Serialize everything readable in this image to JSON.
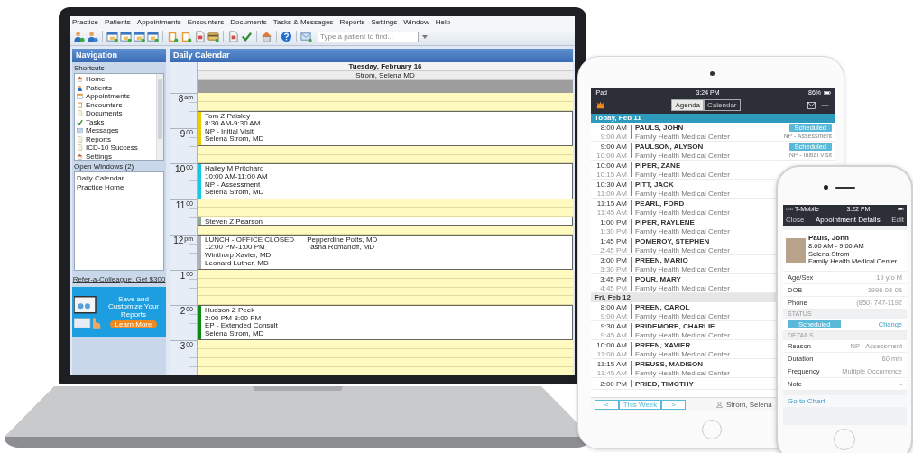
{
  "laptop": {
    "menu": [
      "Practice",
      "Patients",
      "Appointments",
      "Encounters",
      "Documents",
      "Tasks & Messages",
      "Reports",
      "Settings",
      "Window",
      "Help"
    ],
    "search": {
      "placeholder": "Type a patient to find..."
    },
    "navigation": {
      "title": "Navigation",
      "shortcuts_label": "Shortcuts",
      "shortcuts": [
        "Home",
        "Patients",
        "Appointments",
        "Encounters",
        "Documents",
        "Tasks",
        "Messages",
        "Reports",
        "ICD-10 Success",
        "Settings"
      ],
      "open_windows_label": "Open Windows (2)",
      "open_windows": [
        "Daily Calendar",
        "Practice Home"
      ],
      "referral_link": "Refer-a-Colleague, Get $300",
      "ad": {
        "text": "Save and Customize Your Reports",
        "button": "Learn More"
      }
    },
    "calendar": {
      "title": "Daily Calendar",
      "date": "Tuesday, February 16",
      "provider": "Strom, Selena MD",
      "hours": [
        {
          "hour": "8",
          "suffix": "am"
        },
        {
          "hour": "9",
          "suffix": "00"
        },
        {
          "hour": "10",
          "suffix": "00"
        },
        {
          "hour": "11",
          "suffix": "00"
        },
        {
          "hour": "12",
          "suffix": "pm"
        },
        {
          "hour": "1",
          "suffix": "00"
        },
        {
          "hour": "2",
          "suffix": "00"
        },
        {
          "hour": "3",
          "suffix": "00"
        }
      ],
      "slots": [
        {
          "kind": "free"
        },
        {
          "kind": "free"
        },
        {
          "kind": "appointment",
          "short": false,
          "color": "#e8d000",
          "lines": [
            "Tom Z Paisley",
            "8:30 AM-9:30 AM",
            "NP - Initial Visit",
            "Selena Strom, MD"
          ]
        },
        {
          "kind": "free"
        },
        {
          "kind": "free"
        },
        {
          "kind": "appointment",
          "short": false,
          "color": "#18c8e0",
          "lines": [
            "Hailey M Pritchard",
            "10:00 AM-11:00 AM",
            "NP - Assessment",
            "Selena Strom, MD"
          ]
        },
        {
          "kind": "free"
        },
        {
          "kind": "free"
        },
        {
          "kind": "appointment",
          "short": true,
          "color": "#8fa88f",
          "lines": [
            "Steven Z Pearson"
          ]
        },
        {
          "kind": "free"
        },
        {
          "kind": "appointment",
          "short": false,
          "color": "#b0b0b0",
          "lines": [
            "LUNCH - OFFICE CLOSED",
            "12:00 PM-1:00 PM",
            "Winthorp Xavier, MD",
            "Leonard Luther, MD",
            "Pepperdine Potts, MD",
            "Tasha Romanoff, MD"
          ]
        },
        {
          "kind": "free"
        },
        {
          "kind": "free"
        },
        {
          "kind": "free"
        },
        {
          "kind": "free"
        },
        {
          "kind": "appointment",
          "short": false,
          "color": "#108a10",
          "lines": [
            "Hudson Z Peek",
            "2:00 PM-3:00 PM",
            "EP - Extended Consult",
            "Selena Strom, MD"
          ]
        },
        {
          "kind": "free"
        },
        {
          "kind": "free"
        },
        {
          "kind": "free"
        },
        {
          "kind": "free"
        }
      ]
    }
  },
  "tablet": {
    "status_bar": {
      "device": "iPad",
      "time": "3:24 PM",
      "battery": "86%"
    },
    "segments": [
      {
        "label": "Agenda",
        "selected": true
      },
      {
        "label": "Calendar",
        "selected": false
      }
    ],
    "sections": [
      {
        "title": "Today, Feb 11",
        "kind": "today",
        "rows": [
          {
            "start": "8:00 AM",
            "end": "9:00 AM",
            "name": "PAULS, JOHN",
            "location": "Family Health Medical Center",
            "status": "Scheduled",
            "reason": "NP - Assessment"
          },
          {
            "start": "9:00 AM",
            "end": "10:00 AM",
            "name": "PAULSON, ALYSON",
            "location": "Family Health Medical Center",
            "status": "Scheduled",
            "reason": "NP - Initial Visit"
          },
          {
            "start": "10:00 AM",
            "end": "10:15 AM",
            "name": "PIPER, ZANE",
            "location": "Family Health Medical Center"
          },
          {
            "start": "10:30 AM",
            "end": "11:00 AM",
            "name": "PITT, JACK",
            "location": "Family Health Medical Center"
          },
          {
            "start": "11:15 AM",
            "end": "11:45 AM",
            "name": "PEARL, FORD",
            "location": "Family Health Medical Center"
          },
          {
            "start": "1:00 PM",
            "end": "1:30 PM",
            "name": "PIPER, RAYLENE",
            "location": "Family Health Medical Center"
          },
          {
            "start": "1:45 PM",
            "end": "2:45 PM",
            "name": "POMEROY, STEPHEN",
            "location": "Family Health Medical Center"
          },
          {
            "start": "3:00 PM",
            "end": "3:30 PM",
            "name": "PREEN, MARIO",
            "location": "Family Health Medical Center"
          },
          {
            "start": "3:45 PM",
            "end": "4:45 PM",
            "name": "POUR, MARY",
            "location": "Family Health Medical Center"
          }
        ]
      },
      {
        "title": "Fri, Feb 12",
        "kind": "later",
        "rows": [
          {
            "start": "8:00 AM",
            "end": "9:00 AM",
            "name": "PREEN, CAROL",
            "location": "Family Health Medical Center"
          },
          {
            "start": "9:30 AM",
            "end": "9:45 AM",
            "name": "PRIDEMORE, CHARLIE",
            "location": "Family Health Medical Center"
          },
          {
            "start": "10:00 AM",
            "end": "11:00 AM",
            "name": "PREEN, XAVIER",
            "location": "Family Health Medical Center"
          },
          {
            "start": "11:15 AM",
            "end": "11:45 AM",
            "name": "PREUSS, MADISON",
            "location": "Family Health Medical Center"
          },
          {
            "start": "2:00 PM",
            "name": "PRIED, TIMOTHY"
          }
        ]
      }
    ],
    "bottom_bar": {
      "previous": "<",
      "range": "This Week",
      "next": ">",
      "provider": "Strom, Selena"
    }
  },
  "phone": {
    "status_bar": {
      "carrier": "T-Mobile",
      "time": "3:22 PM"
    },
    "nav": {
      "left": "Close",
      "title": "Appointment Details",
      "right": "Edit"
    },
    "patient": {
      "name": "Pauls, John",
      "time": "8:00 AM - 9:00 AM",
      "provider": "Selena Strom",
      "location": "Family Health Medical Center"
    },
    "fields": [
      {
        "label": "Age/Sex",
        "value": "19 y/o M"
      },
      {
        "label": "DOB",
        "value": "1996-08-05"
      },
      {
        "label": "Phone",
        "value": "(850) 747-1192"
      }
    ],
    "status_header": "STATUS",
    "status": "Scheduled",
    "change": "Change",
    "details_header": "DETAILS",
    "details": [
      {
        "label": "Reason",
        "value": "NP - Assessment"
      },
      {
        "label": "Duration",
        "value": "60 min"
      },
      {
        "label": "Frequency",
        "value": "Multiple Occurrence"
      },
      {
        "label": "Note",
        "value": "-"
      }
    ],
    "footer": "Go to Chart"
  }
}
